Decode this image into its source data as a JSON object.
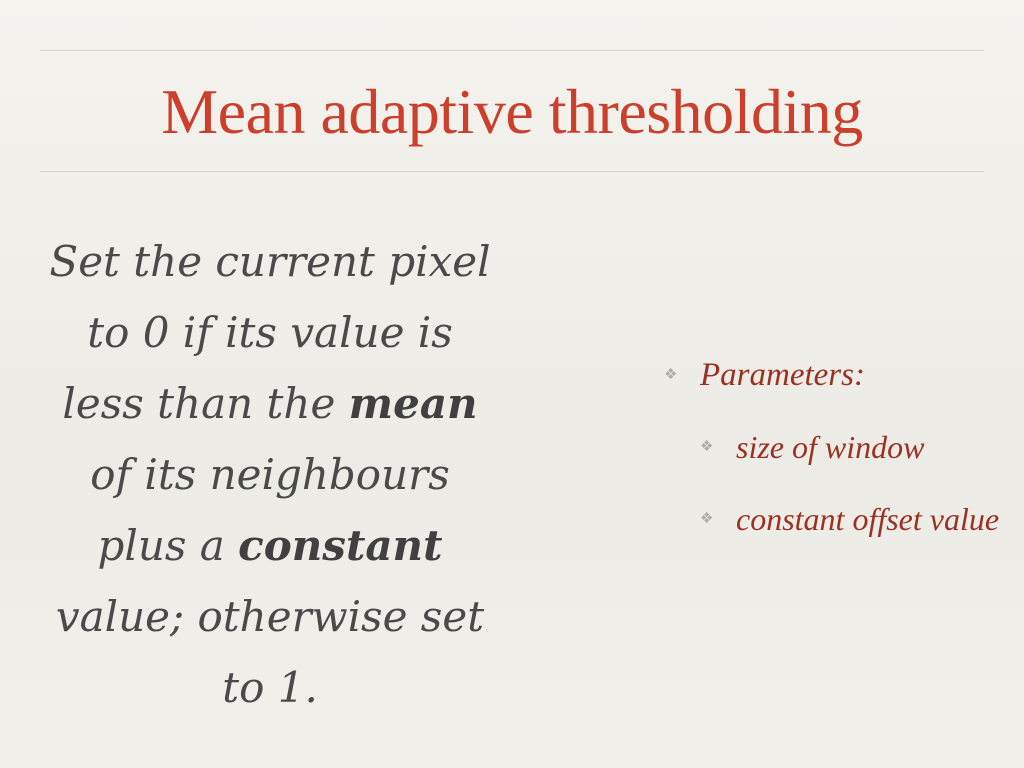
{
  "slide": {
    "title": "Mean adaptive thresholding",
    "body": {
      "part1": "Set the current pixel to 0 if its value is less than the ",
      "bold1": "mean",
      "part2": " of its neighbours plus a ",
      "bold2": "constant",
      "part3": " value; otherwise set to 1."
    },
    "bullets": {
      "main": "Parameters:",
      "sub1": "size of window",
      "sub2": "constant offset value"
    },
    "bullet_symbol": "❖"
  }
}
